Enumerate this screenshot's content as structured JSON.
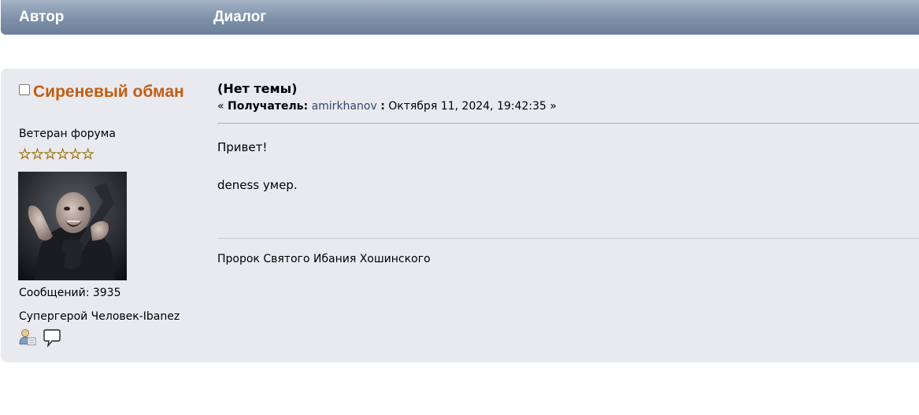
{
  "header": {
    "author_label": "Автор",
    "dialog_label": "Диалог"
  },
  "poster": {
    "name": "Сиреневый обман",
    "rank": "Ветеран форума",
    "stars": "☆☆☆☆☆☆",
    "post_count": "Сообщений: 3935",
    "personal_text": "Супергерой Человек-Ibanez"
  },
  "message": {
    "subject": "(Нет темы)",
    "meta_open": "«",
    "recipient_label": "Получатель:",
    "recipient": "amirkhanov",
    "meta_sep": ":",
    "date": "Октября 11, 2024, 19:42:35",
    "meta_close": "»",
    "body": [
      "Привет!",
      "deness умер."
    ],
    "signature": "Пророк Святого Ибания Хошинского"
  },
  "colors": {
    "header_bg": "#7d90a8",
    "post_bg": "#e8eaef",
    "username": "#c35d10",
    "link": "#334466"
  }
}
